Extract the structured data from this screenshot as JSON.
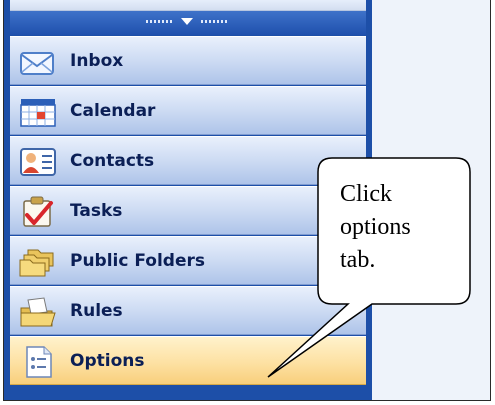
{
  "sidebar": {
    "items": [
      {
        "label": "Inbox",
        "icon": "envelope-icon"
      },
      {
        "label": "Calendar",
        "icon": "calendar-icon"
      },
      {
        "label": "Contacts",
        "icon": "contact-card-icon"
      },
      {
        "label": "Tasks",
        "icon": "task-clipboard-icon"
      },
      {
        "label": "Public Folders",
        "icon": "public-folders-icon"
      },
      {
        "label": "Rules",
        "icon": "rules-folder-icon"
      },
      {
        "label": "Options",
        "icon": "options-page-icon",
        "selected": true
      }
    ]
  },
  "annotation": {
    "line1": "Click",
    "line2": "options",
    "line3": "tab."
  },
  "colors": {
    "sidebar_blue": "#1d4fa8",
    "item_gradient_top": "#e9f0fc",
    "item_gradient_bottom": "#aec4e9",
    "selected_gradient_top": "#fff2cc",
    "selected_gradient_bottom": "#f8cf7c",
    "content_bg": "#eef3fa",
    "label_text": "#0b1f56"
  }
}
